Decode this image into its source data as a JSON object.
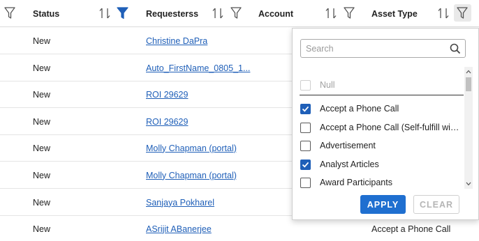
{
  "header": {
    "status": "Status",
    "requesters": "Requesterss",
    "account": "Account",
    "asset_type": "Asset Type"
  },
  "rows": [
    {
      "status": "New",
      "requester": "Christine DaPra",
      "asset_type": ""
    },
    {
      "status": "New",
      "requester": "Auto_FirstName_0805_1...",
      "asset_type": ""
    },
    {
      "status": "New",
      "requester": "ROI 29629",
      "asset_type": ""
    },
    {
      "status": "New",
      "requester": "ROI 29629",
      "asset_type": ""
    },
    {
      "status": "New",
      "requester": "Molly Chapman (portal)",
      "asset_type": ""
    },
    {
      "status": "New",
      "requester": "Molly Chapman (portal)",
      "asset_type": ""
    },
    {
      "status": "New",
      "requester": "Sanjaya Pokharel",
      "asset_type": ""
    },
    {
      "status": "New",
      "requester": "ASrijit ABanerjee",
      "asset_type": "Accept a Phone Call"
    }
  ],
  "filter_popup": {
    "search_placeholder": "Search",
    "null_label": "Null",
    "options": [
      {
        "label": "Accept a Phone Call",
        "checked": true
      },
      {
        "label": "Accept a Phone Call (Self-fulfill with ...",
        "checked": false
      },
      {
        "label": "Advertisement",
        "checked": false
      },
      {
        "label": "Analyst Articles",
        "checked": true
      },
      {
        "label": "Award Participants",
        "checked": false
      }
    ],
    "apply_label": "APPLY",
    "clear_label": "CLEAR"
  },
  "colors": {
    "accent": "#1f6fd0",
    "link": "#1f5fb8",
    "active_filter": "#1f5fb8"
  }
}
